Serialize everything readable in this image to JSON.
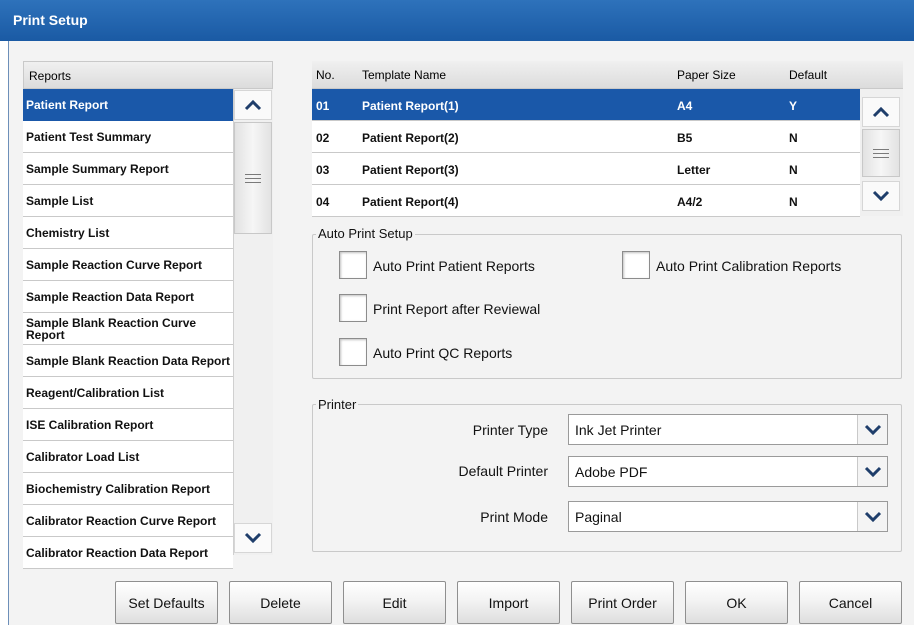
{
  "window": {
    "title": "Print Setup"
  },
  "reports": {
    "header": "Reports",
    "items": [
      "Patient Report",
      "Patient Test Summary",
      "Sample Summary Report",
      "Sample List",
      "Chemistry List",
      "Sample Reaction Curve Report",
      "Sample Reaction Data Report",
      "Sample Blank Reaction Curve Report",
      "Sample Blank Reaction Data Report",
      "Reagent/Calibration List",
      "ISE Calibration Report",
      "Calibrator Load List",
      "Biochemistry Calibration Report",
      "Calibrator Reaction Curve Report",
      "Calibrator Reaction Data Report"
    ],
    "selected_index": 0
  },
  "templates": {
    "columns": {
      "no": "No.",
      "name": "Template Name",
      "paper": "Paper Size",
      "default": "Default"
    },
    "rows": [
      {
        "no": "01",
        "name": "Patient Report(1)",
        "paper": "A4",
        "default": "Y"
      },
      {
        "no": "02",
        "name": "Patient Report(2)",
        "paper": "B5",
        "default": "N"
      },
      {
        "no": "03",
        "name": "Patient Report(3)",
        "paper": "Letter",
        "default": "N"
      },
      {
        "no": "04",
        "name": "Patient Report(4)",
        "paper": "A4/2",
        "default": "N"
      }
    ],
    "selected_index": 0
  },
  "auto_print": {
    "legend": "Auto Print Setup",
    "patient_reports": "Auto Print Patient Reports",
    "calibration_reports": "Auto Print Calibration Reports",
    "after_review": "Print Report after Reviewal",
    "qc_reports": "Auto Print QC Reports",
    "checked": {
      "patient_reports": false,
      "calibration_reports": false,
      "after_review": false,
      "qc_reports": false
    }
  },
  "printer": {
    "legend": "Printer",
    "type_label": "Printer Type",
    "type_value": "Ink Jet Printer",
    "default_label": "Default Printer",
    "default_value": "Adobe PDF",
    "mode_label": "Print Mode",
    "mode_value": "Paginal"
  },
  "buttons": {
    "set_defaults": "Set Defaults",
    "delete": "Delete",
    "edit": "Edit",
    "import": "Import",
    "print_order": "Print Order",
    "ok": "OK",
    "cancel": "Cancel"
  },
  "colors": {
    "titlebar": "#1f62ad",
    "selection": "#1a58a9",
    "background": "#f3f3f3"
  },
  "icons": {
    "scroll_up": "chevron-up-icon",
    "scroll_down": "chevron-down-icon",
    "thumb": "grip-icon",
    "dropdown": "chevron-down-icon"
  }
}
